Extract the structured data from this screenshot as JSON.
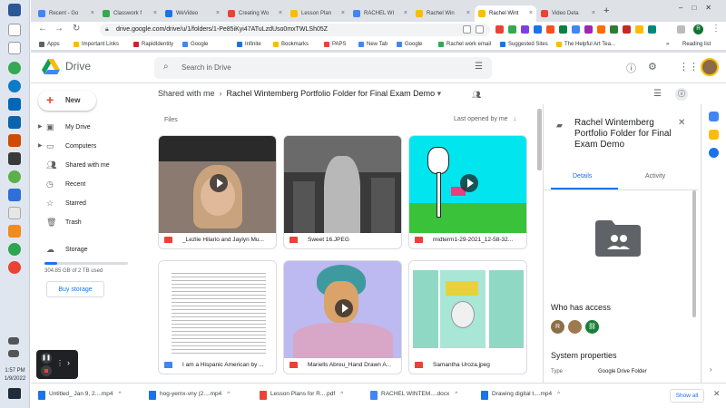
{
  "browser": {
    "tabs": [
      {
        "label": "Recent - Go",
        "color": "#4285f4"
      },
      {
        "label": "Classwork f",
        "color": "#34a853"
      },
      {
        "label": "WeVideo",
        "color": "#1a73e8"
      },
      {
        "label": "Creating Wo",
        "color": "#ea4335"
      },
      {
        "label": "Lesson Plan",
        "color": "#fbbc04"
      },
      {
        "label": "RACHEL WI",
        "color": "#4285f4"
      },
      {
        "label": "Rachel Win",
        "color": "#fbbc04"
      },
      {
        "label": "Rachel Wint",
        "color": "#fbbc04"
      },
      {
        "label": "Video Deta",
        "color": "#ea4335"
      }
    ],
    "active_tab_index": 7,
    "url": "drive.google.com/drive/u/1/folders/1-Pe85iKyi47ATuLzdUso0mxTWLSh05Z",
    "bookmarks": [
      "Apps",
      "Important Links",
      "RapidIdentity",
      "Google",
      "Infinite",
      "Bookmarks",
      "PAPS",
      "New Tab",
      "Google",
      "Rachel work email",
      "Suggested Sites",
      "The Helpful Art Tea..."
    ],
    "reading_list": "Reading list",
    "profile_initial": "R"
  },
  "drive": {
    "app_name": "Drive",
    "search_placeholder": "Search in Drive",
    "new_label": "New",
    "nav": [
      "My Drive",
      "Computers",
      "Shared with me",
      "Recent",
      "Starred",
      "Trash",
      "Storage"
    ],
    "storage_used_fraction": 0.15,
    "storage_text": "304.85 GB of 2 TB used",
    "buy_storage": "Buy storage",
    "breadcrumb_root": "Shared with me",
    "breadcrumb_current": "Rachel Wintemberg Portfolio Folder for Final Exam Demo",
    "files_label": "Files",
    "sort_label": "Last opened by me",
    "files": [
      {
        "name": "_Lezlie Hilario and Jaylyn Mu...",
        "type": "video"
      },
      {
        "name": "Sweet 16.JPEG",
        "type": "image"
      },
      {
        "name": "midterm1-29-2021_12-58-32...",
        "type": "video"
      },
      {
        "name": "I am a Hispanic American by ...",
        "type": "doc"
      },
      {
        "name": "Mariells Abreu_Hand Drawn A...",
        "type": "video"
      },
      {
        "name": "Samantha Uroza.jpeg",
        "type": "image"
      }
    ]
  },
  "details": {
    "title": "Rachel Wintemberg Portfolio Folder for Final Exam Demo",
    "tab_details": "Details",
    "tab_activity": "Activity",
    "who_has_access": "Who has access",
    "access_initials": [
      "R",
      "",
      ""
    ],
    "system_properties": "System properties",
    "type_label": "Type",
    "type_value": "Google Drive Folder"
  },
  "downloads": [
    {
      "name": "Untitled_ Jan 9, 2....mp4",
      "color": "#1a73e8"
    },
    {
      "name": "hog-yemx-vny (2....mp4",
      "color": "#1a73e8"
    },
    {
      "name": "Lesson Plans for R....pdf",
      "color": "#ea4335"
    },
    {
      "name": "RACHEL WINTEM....docx",
      "color": "#4285f4"
    },
    {
      "name": "Drawing digital t....mp4",
      "color": "#1a73e8"
    }
  ],
  "show_all": "Show all",
  "taskbar": {
    "time": "1:57 PM",
    "date": "1/9/2022"
  }
}
